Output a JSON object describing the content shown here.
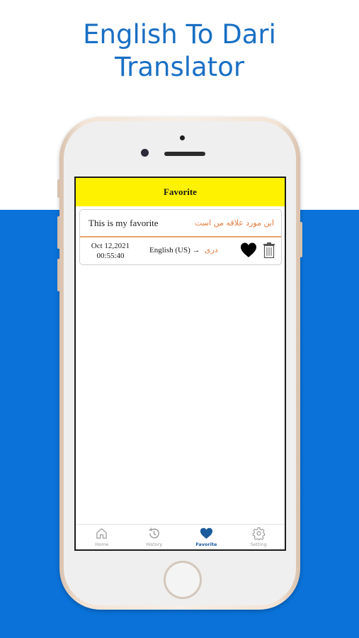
{
  "promo": {
    "title_line1": "English To Dari",
    "title_line2": "Translator"
  },
  "app": {
    "header_title": "Favorite",
    "favorites": [
      {
        "source_text": "This is my favorite",
        "translated_text": "این مورد علاقه من است",
        "date": "Oct 12,2021",
        "time": "00:55:40",
        "source_language": "English (US) →",
        "target_language": "دری"
      }
    ],
    "tabs": [
      {
        "label": "Home",
        "icon": "home-icon"
      },
      {
        "label": "History",
        "icon": "history-icon"
      },
      {
        "label": "Favorite",
        "icon": "heart-icon"
      },
      {
        "label": "Setting",
        "icon": "gear-icon"
      }
    ]
  },
  "colors": {
    "header_bg": "#fff200",
    "accent_blue": "#0a72d8",
    "title_blue": "#1a6fc4",
    "translation_orange": "#e07a3c"
  }
}
